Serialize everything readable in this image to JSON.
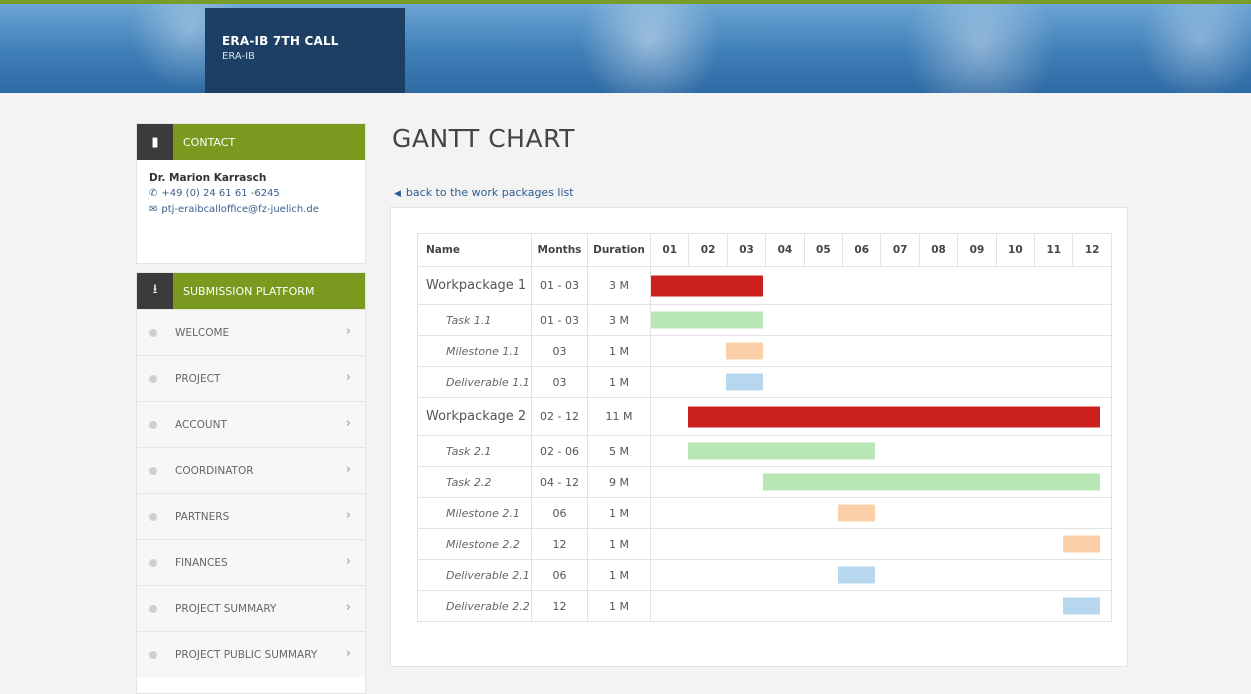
{
  "header": {
    "title": "ERA-IB 7TH CALL",
    "subtitle": "ERA-IB"
  },
  "contact": {
    "heading": "CONTACT",
    "name": "Dr. Marion Karrasch",
    "phone": "+49 (0) 24 61 61 -6245",
    "email": "ptj-eraibcalloffice@fz-juelich.de",
    "icon": "chat-icon"
  },
  "submission": {
    "heading": "SUBMISSION PLATFORM",
    "icon": "download-icon",
    "items": [
      "WELCOME",
      "PROJECT",
      "ACCOUNT",
      "COORDINATOR",
      "PARTNERS",
      "FINANCES",
      "PROJECT SUMMARY",
      "PROJECT PUBLIC SUMMARY"
    ]
  },
  "page": {
    "title": "GANTT CHART",
    "back_link": "back to the work packages list"
  },
  "gantt": {
    "headers": {
      "name": "Name",
      "months": "Months",
      "duration": "Duration"
    },
    "month_labels": [
      "01",
      "02",
      "03",
      "04",
      "05",
      "06",
      "07",
      "08",
      "09",
      "10",
      "11",
      "12"
    ],
    "colors": {
      "workpackage": "#cc1f1f",
      "task": "#b8e6b4",
      "milestone": "#fbd0a8",
      "deliverable": "#b7d7ef"
    },
    "rows": [
      {
        "name": "Workpackage 1",
        "months": "01 - 03",
        "duration": "3 M",
        "kind": "workpackage",
        "start": 1,
        "end": 3
      },
      {
        "name": "Task 1.1",
        "months": "01 - 03",
        "duration": "3 M",
        "kind": "task",
        "start": 1,
        "end": 3
      },
      {
        "name": "Milestone 1.1",
        "months": "03",
        "duration": "1 M",
        "kind": "milestone",
        "start": 3,
        "end": 3
      },
      {
        "name": "Deliverable 1.1",
        "months": "03",
        "duration": "1 M",
        "kind": "deliverable",
        "start": 3,
        "end": 3
      },
      {
        "name": "Workpackage 2",
        "months": "02 - 12",
        "duration": "11 M",
        "kind": "workpackage",
        "start": 2,
        "end": 12
      },
      {
        "name": "Task 2.1",
        "months": "02 - 06",
        "duration": "5 M",
        "kind": "task",
        "start": 2,
        "end": 6
      },
      {
        "name": "Task 2.2",
        "months": "04 - 12",
        "duration": "9 M",
        "kind": "task",
        "start": 4,
        "end": 12
      },
      {
        "name": "Milestone 2.1",
        "months": "06",
        "duration": "1 M",
        "kind": "milestone",
        "start": 6,
        "end": 6
      },
      {
        "name": "Milestone 2.2",
        "months": "12",
        "duration": "1 M",
        "kind": "milestone",
        "start": 12,
        "end": 12
      },
      {
        "name": "Deliverable 2.1",
        "months": "06",
        "duration": "1 M",
        "kind": "deliverable",
        "start": 6,
        "end": 6
      },
      {
        "name": "Deliverable 2.2",
        "months": "12",
        "duration": "1 M",
        "kind": "deliverable",
        "start": 12,
        "end": 12
      }
    ]
  }
}
